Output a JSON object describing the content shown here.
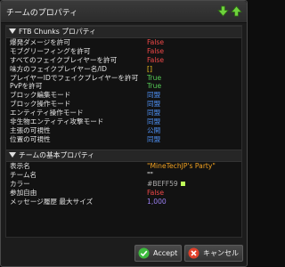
{
  "window": {
    "title": "チームのプロパティ",
    "up_icon": "green-up-arrow",
    "down_icon": "green-down-arrow"
  },
  "ftb_section": {
    "header": "FTB Chunks プロパティ",
    "rows": [
      {
        "label": "爆発ダメージを許可",
        "value": "False",
        "kind": "false"
      },
      {
        "label": "モブグリーフィングを許可",
        "value": "False",
        "kind": "false"
      },
      {
        "label": "すべてのフェイクプレイヤーを許可",
        "value": "False",
        "kind": "false"
      },
      {
        "label": "味方のフェイクプレイヤー名/ID",
        "value": "[]",
        "kind": "yellow"
      },
      {
        "label": "プレイヤーIDでフェイクプレイヤーを許可",
        "value": "True",
        "kind": "true"
      },
      {
        "label": "PvPを許可",
        "value": "True",
        "kind": "true"
      },
      {
        "label": "ブロック編集モード",
        "value": "同盟",
        "kind": "blue"
      },
      {
        "label": "ブロック操作モード",
        "value": "同盟",
        "kind": "blue"
      },
      {
        "label": "エンティティ操作モード",
        "value": "同盟",
        "kind": "blue"
      },
      {
        "label": "非生物エンティティ攻撃モード",
        "value": "同盟",
        "kind": "blue"
      },
      {
        "label": "主張の可視性",
        "value": "公開",
        "kind": "blue"
      },
      {
        "label": "位置の可視性",
        "value": "同盟",
        "kind": "blue"
      }
    ]
  },
  "team_section": {
    "header": "チームの基本プロパティ",
    "rows": [
      {
        "label": "表示名",
        "value": "\"MineTechJP's Party\"",
        "kind": "orange"
      },
      {
        "label": "チーム名",
        "value": "\"\"",
        "kind": "white"
      },
      {
        "label": "カラー",
        "value": "#BEFF59",
        "kind": "hex",
        "swatch": "#BEFF59"
      },
      {
        "label": "参加自由",
        "value": "False",
        "kind": "false"
      },
      {
        "label": "メッセージ履歴 最大サイズ",
        "value": "1,000",
        "kind": "num"
      }
    ]
  },
  "buttons": {
    "accept": "Accept",
    "cancel": "キャンセル"
  },
  "colors": {
    "false": "#f04848",
    "true": "#55cc55",
    "blue": "#4d8ef0",
    "yellow": "#f2c21c",
    "orange": "#f0a020",
    "accept_icon": "#3dbb3d",
    "cancel_icon": "#e0402a"
  }
}
